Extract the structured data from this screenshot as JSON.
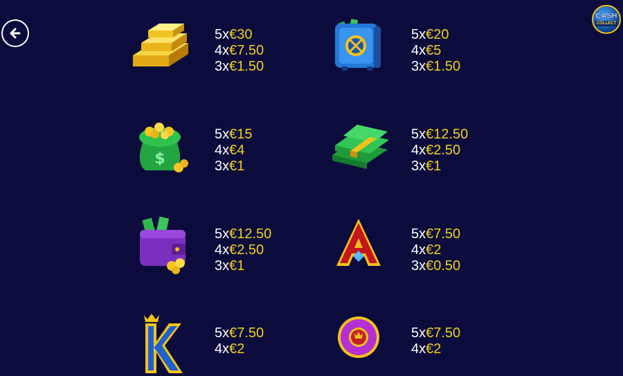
{
  "nav": {
    "back_icon": "arrow-left-icon"
  },
  "logo": {
    "line1": "CASH",
    "line2": "COLLECT"
  },
  "colors": {
    "background": "#0b0c3c",
    "multiplier_text": "#ffffff",
    "value_text": "#f2cf1c"
  },
  "paytable": [
    {
      "symbol": "gold-bars-icon",
      "pays": [
        {
          "mult": "5x",
          "value": "€30"
        },
        {
          "mult": "4x",
          "value": "€7.50"
        },
        {
          "mult": "3x",
          "value": "€1.50"
        }
      ]
    },
    {
      "symbol": "safe-icon",
      "pays": [
        {
          "mult": "5x",
          "value": "€20"
        },
        {
          "mult": "4x",
          "value": "€5"
        },
        {
          "mult": "3x",
          "value": "€1.50"
        }
      ]
    },
    {
      "symbol": "money-bag-icon",
      "pays": [
        {
          "mult": "5x",
          "value": "€15"
        },
        {
          "mult": "4x",
          "value": "€4"
        },
        {
          "mult": "3x",
          "value": "€1"
        }
      ]
    },
    {
      "symbol": "cash-stacks-icon",
      "pays": [
        {
          "mult": "5x",
          "value": "€12.50"
        },
        {
          "mult": "4x",
          "value": "€2.50"
        },
        {
          "mult": "3x",
          "value": "€1"
        }
      ]
    },
    {
      "symbol": "wallet-icon",
      "pays": [
        {
          "mult": "5x",
          "value": "€12.50"
        },
        {
          "mult": "4x",
          "value": "€2.50"
        },
        {
          "mult": "3x",
          "value": "€1"
        }
      ]
    },
    {
      "symbol": "letter-a-icon",
      "pays": [
        {
          "mult": "5x",
          "value": "€7.50"
        },
        {
          "mult": "4x",
          "value": "€2"
        },
        {
          "mult": "3x",
          "value": "€0.50"
        }
      ]
    },
    {
      "symbol": "letter-k-icon",
      "pays": [
        {
          "mult": "5x",
          "value": "€7.50"
        },
        {
          "mult": "4x",
          "value": "€2"
        }
      ]
    },
    {
      "symbol": "letter-q-icon",
      "pays": [
        {
          "mult": "5x",
          "value": "€7.50"
        },
        {
          "mult": "4x",
          "value": "€2"
        }
      ]
    }
  ]
}
